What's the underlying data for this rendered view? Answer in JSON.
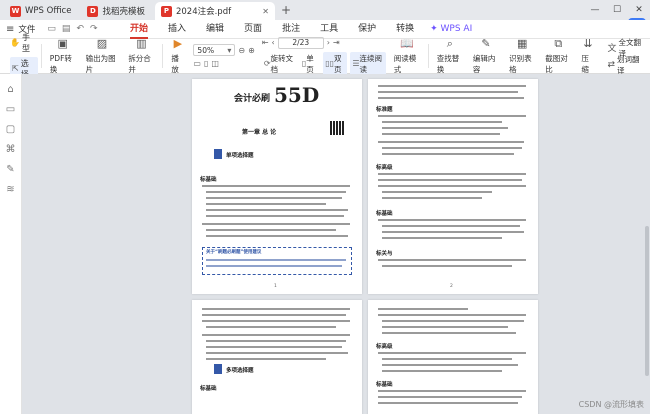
{
  "titlebar": {
    "tabs": [
      {
        "label": "WPS Office",
        "logo_color": "#e0362b",
        "logo_text": "W"
      },
      {
        "label": "找稻壳模板",
        "logo_color": "#e0362b",
        "logo_text": "D"
      },
      {
        "label": "2024注会.pdf",
        "logo_color": "#e0362b",
        "logo_text": "P"
      }
    ],
    "new_tab": "+",
    "win_controls": [
      "—",
      "☐",
      "✕"
    ]
  },
  "menubar": {
    "file_label": "文件",
    "items": [
      "开始",
      "插入",
      "编辑",
      "页面",
      "批注",
      "工具",
      "保护",
      "转换"
    ],
    "active": "开始",
    "ai_label": "WPS AI"
  },
  "toolbar": {
    "hand": "手型",
    "select": "选择",
    "pdf_convert": "PDF转换",
    "output_image": "输出为图片",
    "split_merge": "拆分合并",
    "play": "播放",
    "zoom_value": "50%",
    "page_value": "2/23",
    "rotate_doc": "旋转文档",
    "single_page": "单页",
    "double_page": "双页",
    "continuous": "连续阅读",
    "reading_mode": "阅读模式",
    "find_replace": "查找替换",
    "edit_content": "编辑内容",
    "recognize_table": "识别表格",
    "screenshot_compare": "截图对比",
    "compress": "压缩",
    "full_translate": "全文翻译",
    "word_translate": "划词翻译"
  },
  "document": {
    "page1_title_prefix": "会计必刷",
    "page1_title_big": "55D",
    "chapter_title": "第一章  总    论",
    "section1": "单项选择题",
    "section_basic": "标基础",
    "section_advanced": "标高级",
    "section_multi": "多项选择题",
    "note_title": "关于“刷题必刷题”使用建议",
    "page_num_1": "1",
    "page_num_2": "2",
    "right_label_1": "标准题",
    "right_label_2": "标高级",
    "right_label_3": "标基础",
    "right_label_4": "标关与",
    "watermark": "CSDN @流形填表"
  }
}
